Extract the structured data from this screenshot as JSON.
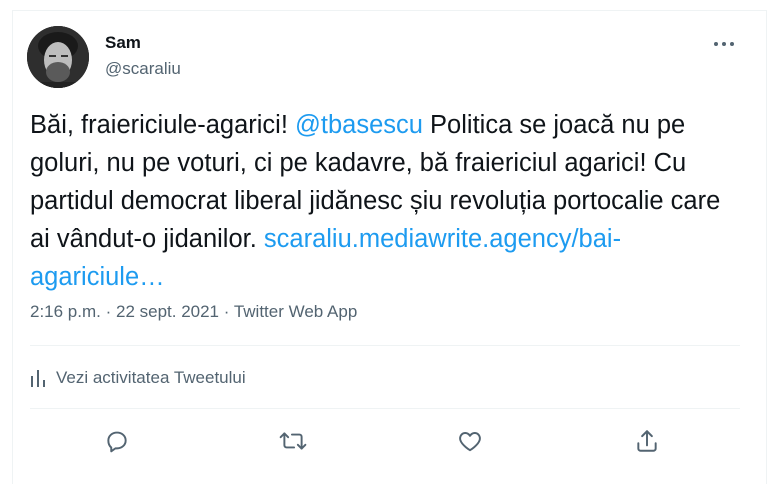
{
  "tweet": {
    "author_name": "Sam",
    "author_handle": "@scaraliu",
    "text_before": "Băi, fraiericiule-agarici! ",
    "mention": "@tbasescu",
    "text_after": " Politica se joacă nu pe goluri, nu pe voturi, ci pe kadavre, bă fraiericiul agarici! Cu partidul democrat liberal jidănesc șiu revoluția portocalie care ai vândut-o jidanilor. ",
    "link_text": "scaraliu.mediawrite.agency/bai-agariciule…",
    "time": "2:16 p.m.",
    "separator": " · ",
    "date": "22 sept. 2021",
    "source": "Twitter Web App"
  },
  "activity": {
    "label": "Vezi activitatea Tweetului",
    "icon": "activity-bars-icon"
  },
  "actions": [
    {
      "name": "reply",
      "icon": "reply-icon"
    },
    {
      "name": "retweet",
      "icon": "retweet-icon"
    },
    {
      "name": "like",
      "icon": "heart-icon"
    },
    {
      "name": "share",
      "icon": "share-icon"
    }
  ],
  "colors": {
    "accent": "#1d9bf0",
    "secondary_text": "#536471",
    "primary_text": "#0f1419",
    "divider": "#eff3f4"
  }
}
